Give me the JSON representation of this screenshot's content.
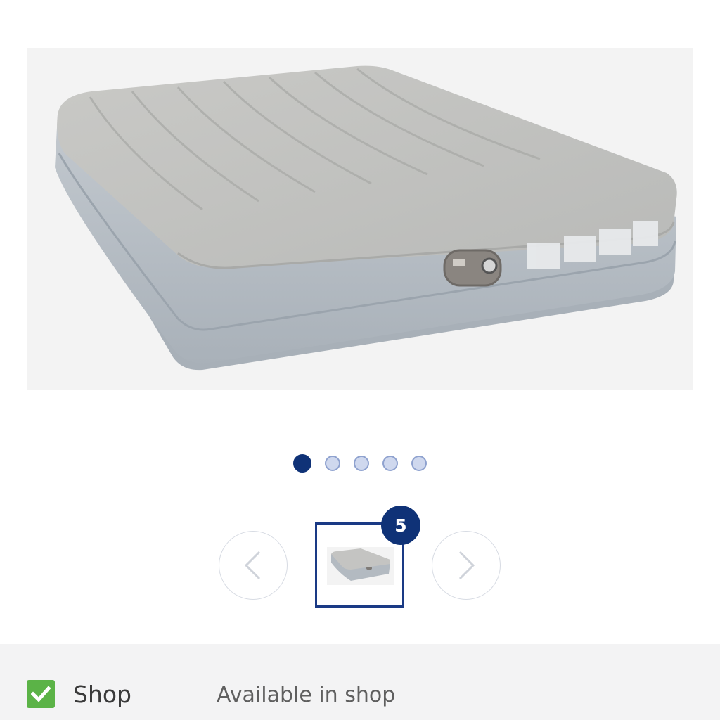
{
  "gallery": {
    "main_image": "inflatable-air-mattress",
    "slide_count": 5,
    "active_slide": 1,
    "thumbnail_count": "5"
  },
  "availability": {
    "channel_label": "Shop",
    "status_text": "Available in shop",
    "status_icon": "check-icon",
    "accent_color": "#5bb347"
  },
  "theme": {
    "primary": "#0f3277",
    "dot_inactive": "#cfd8ee"
  }
}
